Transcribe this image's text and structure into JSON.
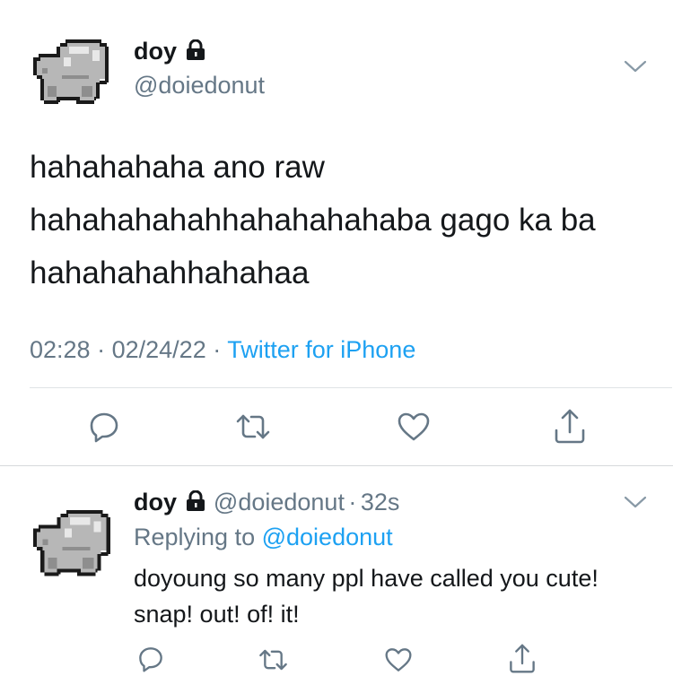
{
  "main_tweet": {
    "display_name": "doy",
    "handle": "@doiedonut",
    "text": "hahahahaha ano raw hahahahahahhahahahahaba gago ka ba hahahahahhahahaa",
    "time": "02:28",
    "sep1": "·",
    "date": "02/24/22",
    "sep2": "·",
    "source": "Twitter for iPhone",
    "actions": [
      "reply-icon",
      "retweet-icon",
      "like-icon",
      "share-icon"
    ]
  },
  "reply_tweet": {
    "display_name": "doy",
    "handle": "@doiedonut",
    "sep": "·",
    "age": "32s",
    "replying_prefix": "Replying to",
    "replying_to": "@doiedonut",
    "text": "doyoung so many ppl have called you cute! snap! out! of! it!",
    "actions": [
      "reply-icon",
      "retweet-icon",
      "like-icon",
      "share-icon"
    ]
  },
  "colors": {
    "text": "#14171a",
    "secondary": "#657786",
    "link": "#1da1f2",
    "divider": "#dfe3e6"
  }
}
